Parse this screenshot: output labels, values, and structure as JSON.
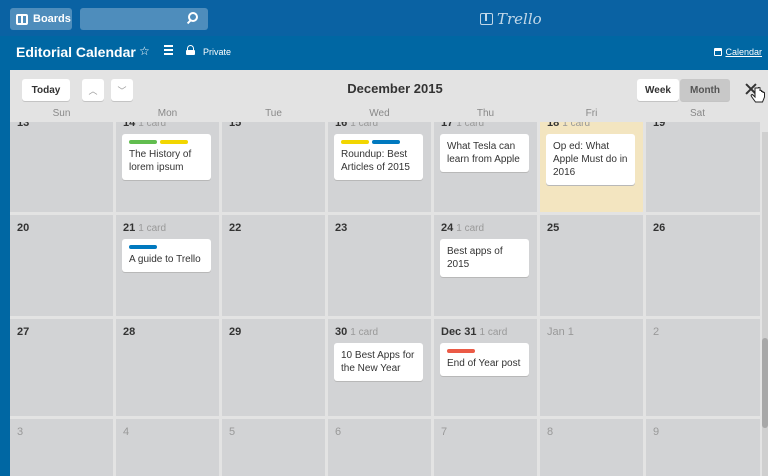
{
  "topbar": {
    "boards_label": "Boards",
    "search_value": "",
    "logo_text": "Trello"
  },
  "board": {
    "title": "Editorial Calendar",
    "privacy": "Private",
    "calendar_link": "Calendar",
    "colors": {
      "header_bg": "#0067a3",
      "topbar_bg": "#0a62a3"
    }
  },
  "calendar": {
    "today_label": "Today",
    "prev_icon": "^",
    "next_icon": "v",
    "month_title": "December 2015",
    "view_week": "Week",
    "view_month": "Month",
    "active_view": "Month",
    "weekdays": [
      "Sun",
      "Mon",
      "Tue",
      "Wed",
      "Thu",
      "Fri",
      "Sat"
    ],
    "week1": {
      "sun": "13",
      "mon": "14",
      "mon_count": "1 card",
      "tue": "15",
      "wed": "16",
      "wed_count": "1 card",
      "thu": "17",
      "thu_count": "1 card",
      "fri": "18",
      "fri_count": "1 card",
      "sat": "19"
    },
    "week2": {
      "sun": "20",
      "mon": "21",
      "mon_count": "1 card",
      "tue": "22",
      "wed": "23",
      "thu": "24",
      "thu_count": "1 card",
      "fri": "25",
      "sat": "26"
    },
    "week3": {
      "sun": "27",
      "mon": "28",
      "tue": "29",
      "wed": "30",
      "wed_count": "1 card",
      "thu": "Dec 31",
      "thu_count": "1 card",
      "fri": "Jan 1",
      "sat": "2"
    },
    "week4": {
      "sun": "3",
      "mon": "4",
      "tue": "5",
      "wed": "6",
      "thu": "7",
      "fri": "8",
      "sat": "9"
    },
    "cards": {
      "history": "The History of lorem ipsum",
      "roundup": "Roundup: Best Articles of 2015",
      "tesla": "What Tesla can learn from Apple",
      "oped": "Op ed: What Apple Must do in 2016",
      "guide": "A guide to Trello",
      "bestapps": "Best apps of 2015",
      "tenbest": "10 Best Apps for the New Year",
      "endyear": "End of Year post"
    },
    "label_colors": {
      "green": "#61bd4f",
      "yellow": "#f2d600",
      "blue": "#0079bf",
      "red": "#eb5a46"
    },
    "today_bg": "#f3e5c0"
  }
}
